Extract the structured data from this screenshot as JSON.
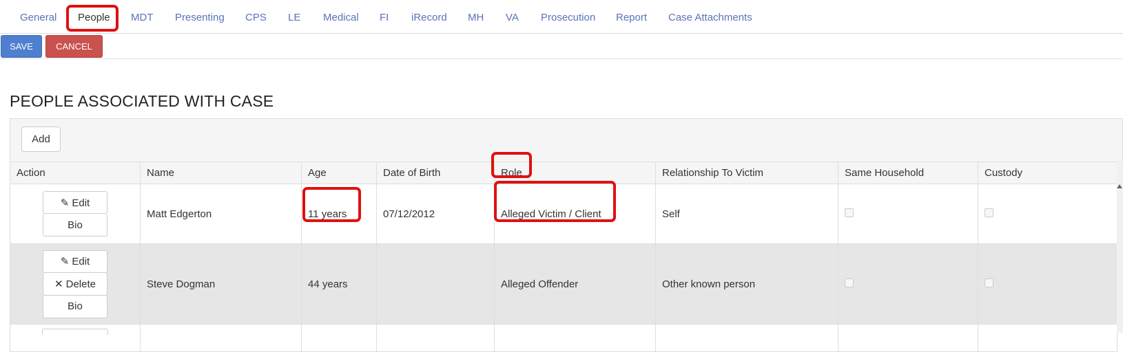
{
  "tabs": [
    "General",
    "People",
    "MDT",
    "Presenting",
    "CPS",
    "LE",
    "Medical",
    "FI",
    "iRecord",
    "MH",
    "VA",
    "Prosecution",
    "Report",
    "Case Attachments"
  ],
  "active_tab": "People",
  "toolbar": {
    "save_label": "SAVE",
    "cancel_label": "CANCEL"
  },
  "section_title": "PEOPLE ASSOCIATED WITH CASE",
  "add_label": "Add",
  "columns": [
    "Action",
    "Name",
    "Age",
    "Date of Birth",
    "Role",
    "Relationship To Victim",
    "Same Household",
    "Custody"
  ],
  "actions": {
    "edit": "Edit",
    "delete": "Delete",
    "bio": "Bio"
  },
  "rows": [
    {
      "name": "Matt Edgerton",
      "age": "11 years",
      "dob": "07/12/2012",
      "role": "Alleged Victim / Client",
      "relationship": "Self",
      "same_household": false,
      "custody": false
    },
    {
      "name": "Steve Dogman",
      "age": "44 years",
      "dob": "",
      "role": "Alleged Offender",
      "relationship": "Other known person",
      "same_household": false,
      "custody": false
    }
  ],
  "colors": {
    "accent": "#5a73b8",
    "save": "#4f7fcf",
    "cancel": "#c9524e",
    "highlight": "#e01010"
  }
}
